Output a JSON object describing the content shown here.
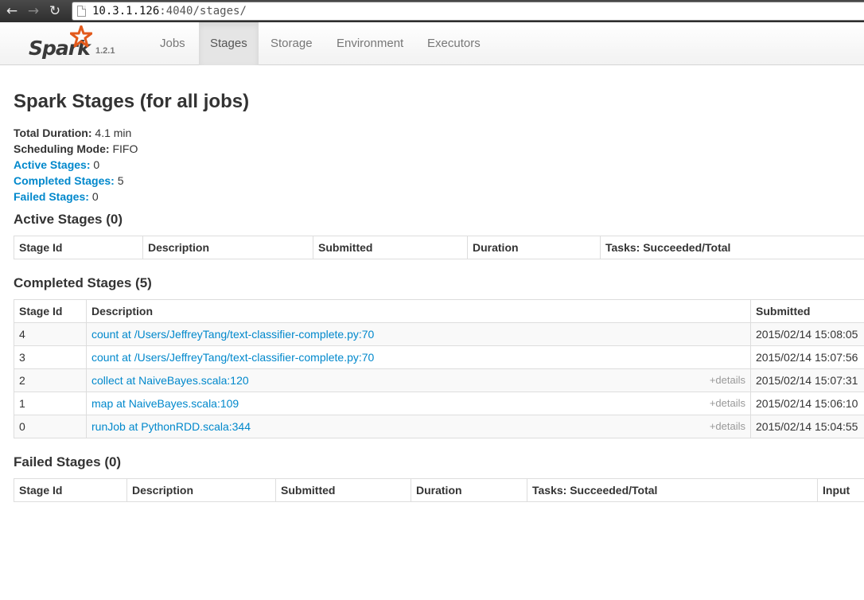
{
  "browser": {
    "url_host": "10.3.1.126",
    "url_rest": ":4040/stages/"
  },
  "navbar": {
    "brand": "Spark",
    "version": "1.2.1",
    "tabs": [
      {
        "label": "Jobs",
        "active": false
      },
      {
        "label": "Stages",
        "active": true
      },
      {
        "label": "Storage",
        "active": false
      },
      {
        "label": "Environment",
        "active": false
      },
      {
        "label": "Executors",
        "active": false
      }
    ]
  },
  "page": {
    "title": "Spark Stages (for all jobs)",
    "summary": {
      "total_duration_label": "Total Duration:",
      "total_duration_value": "4.1 min",
      "scheduling_mode_label": "Scheduling Mode:",
      "scheduling_mode_value": "FIFO",
      "active_label": "Active Stages:",
      "active_value": "0",
      "completed_label": "Completed Stages:",
      "completed_value": "5",
      "failed_label": "Failed Stages:",
      "failed_value": "0"
    }
  },
  "active_stages": {
    "heading": "Active Stages (0)",
    "columns": [
      "Stage Id",
      "Description",
      "Submitted",
      "Duration",
      "Tasks: Succeeded/Total"
    ]
  },
  "completed_stages": {
    "heading": "Completed Stages (5)",
    "columns": [
      "Stage Id",
      "Description",
      "Submitted"
    ],
    "rows": [
      {
        "id": "4",
        "description": "count at /Users/JeffreyTang/text-classifier-complete.py:70",
        "details": "",
        "submitted": "2015/02/14 15:08:05"
      },
      {
        "id": "3",
        "description": "count at /Users/JeffreyTang/text-classifier-complete.py:70",
        "details": "",
        "submitted": "2015/02/14 15:07:56"
      },
      {
        "id": "2",
        "description": "collect at NaiveBayes.scala:120",
        "details": "+details",
        "submitted": "2015/02/14 15:07:31"
      },
      {
        "id": "1",
        "description": "map at NaiveBayes.scala:109",
        "details": "+details",
        "submitted": "2015/02/14 15:06:10"
      },
      {
        "id": "0",
        "description": "runJob at PythonRDD.scala:344",
        "details": "+details",
        "submitted": "2015/02/14 15:04:55"
      }
    ]
  },
  "failed_stages": {
    "heading": "Failed Stages (0)",
    "columns": [
      "Stage Id",
      "Description",
      "Submitted",
      "Duration",
      "Tasks: Succeeded/Total",
      "Input"
    ]
  },
  "colors": {
    "link": "#0088cc",
    "active_tab_bg": "#e5e5e5",
    "spark_orange": "#e25a1c"
  }
}
